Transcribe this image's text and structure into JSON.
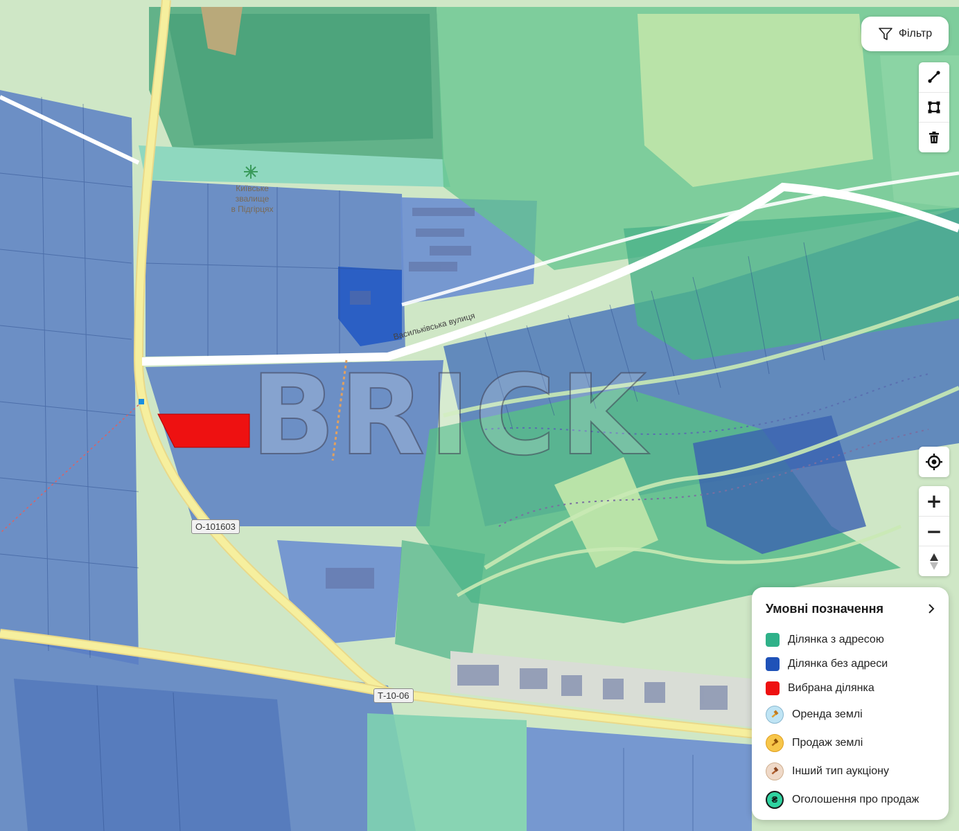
{
  "map": {
    "poi_label": "Київське\nзвалище\nв Підгірцях",
    "street_label": "Васильківська вулиця",
    "road_shields": [
      "О-101603",
      "Т-10-06"
    ],
    "watermark": "BRICK"
  },
  "controls": {
    "filter_label": "Фільтр",
    "tools": [
      "line-draw-icon",
      "polygon-draw-icon",
      "trash-icon"
    ],
    "locate_icon": "locate-icon",
    "zoom_in_label": "+",
    "zoom_out_label": "−",
    "compass_label": "▲"
  },
  "legend": {
    "title": "Умовні позначення",
    "chevron": "›",
    "items": [
      {
        "label": "Ділянка з адресою",
        "color": "#2fb189",
        "kind": "swatch"
      },
      {
        "label": "Ділянка без адреси",
        "color": "#1f52b8",
        "kind": "swatch"
      },
      {
        "label": "Вибрана ділянка",
        "color": "#ee1111",
        "kind": "swatch"
      },
      {
        "label": "Оренда землі",
        "color": "#bfe4f4",
        "kind": "gavel",
        "icon_color": "#e0a030"
      },
      {
        "label": "Продаж землі",
        "color": "#f7c64a",
        "kind": "gavel",
        "icon_color": "#c77a10"
      },
      {
        "label": "Інший тип аукціону",
        "color": "#efd9c8",
        "kind": "gavel",
        "icon_color": "#b06030"
      },
      {
        "label": "Оголошення про продаж",
        "color": "#2fd3a0",
        "kind": "currency",
        "icon_text": "₴"
      }
    ]
  },
  "colors": {
    "parcel_with_address": "#3fb58c",
    "parcel_without_address": "#3a62b8",
    "selected_parcel": "#ee1111",
    "road": "#f3e7a0",
    "forest": "#b9e3a8"
  }
}
